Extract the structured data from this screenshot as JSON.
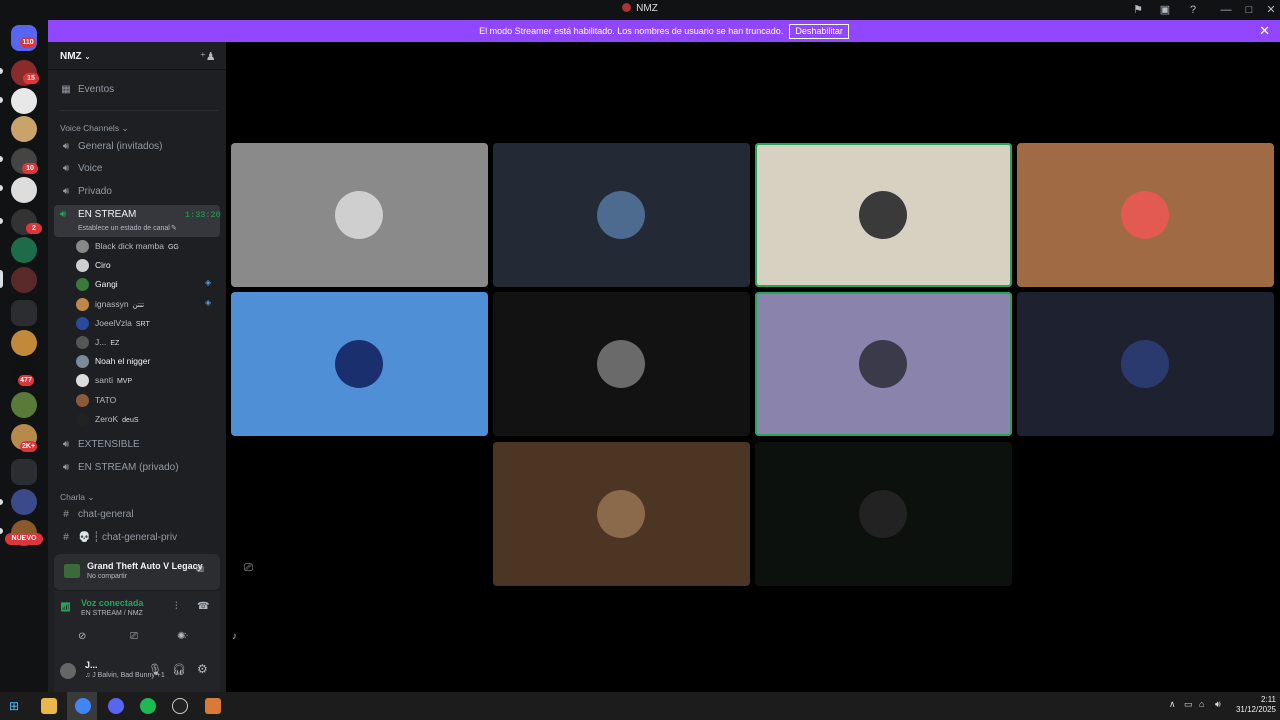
{
  "window": {
    "title": "NMZ"
  },
  "streamer_banner": {
    "message": "El modo Streamer está habilitado. Los nombres de usuario se han truncado.",
    "disable_label": "Deshabilitar"
  },
  "rail_badges": [
    "110",
    "15",
    "10",
    "2",
    "477",
    "2K+"
  ],
  "rail_new_label": "NUEVO",
  "server": {
    "name": "NMZ"
  },
  "events_label": "Eventos",
  "voice_category": "Voice Channels",
  "channels": [
    {
      "name": "General (invitados)"
    },
    {
      "name": "Voice"
    },
    {
      "name": "Privado"
    }
  ],
  "active_channel": {
    "name": "EN STREAM",
    "timer": "1:33:20",
    "status": "Establece un estado de canal"
  },
  "voice_users": [
    {
      "name": "Black dick mamba",
      "tag": "GG",
      "color": "#888888"
    },
    {
      "name": "Ciro",
      "tag": "",
      "color": "#cfcfcf"
    },
    {
      "name": "Gangi",
      "tag": "",
      "color": "#3a7a3a"
    },
    {
      "name": "ignassyn",
      "tag": "تتتن",
      "color": "#c0874a"
    },
    {
      "name": "JoeelVzla",
      "tag": "SRT",
      "color": "#2a4a9a"
    },
    {
      "name": "J...",
      "tag": "EZ",
      "color": "#555555"
    },
    {
      "name": "Noah el nigger",
      "tag": "",
      "color": "#7a8a9a"
    },
    {
      "name": "santi",
      "tag": "MVP",
      "color": "#dddddd"
    },
    {
      "name": "TATO",
      "tag": "",
      "color": "#8a5a3a"
    },
    {
      "name": "ZeroK",
      "tag": "deuS",
      "color": "#222222"
    }
  ],
  "more_channels": [
    {
      "name": "EXTENSIBLE"
    },
    {
      "name": "EN STREAM (privado)"
    }
  ],
  "text_category": "Charla",
  "text_channels": [
    {
      "name": "chat-general"
    },
    {
      "name": "💀 ┆ chat-general-priv"
    }
  ],
  "activity": {
    "game": "Grand Theft Auto V Legacy",
    "status": "No compartir"
  },
  "voice_connection": {
    "status": "Voz conectada",
    "location": "EN STREAM / NMZ"
  },
  "user": {
    "name": "J...",
    "status": "J Balvin, Bad Bunny +1"
  },
  "tiles": [
    {
      "bg": "#8a8a8a",
      "avatar": "#cfcfcf",
      "speaking": false
    },
    {
      "bg": "#232a35",
      "avatar": "#4d6a8f",
      "speaking": false
    },
    {
      "bg": "#d6d1c1",
      "avatar": "#3a3a3a",
      "speaking": true
    },
    {
      "bg": "#a06a45",
      "avatar": "#e25a52",
      "speaking": false
    },
    {
      "bg": "#4e8fd6",
      "avatar": "#1a2f6e",
      "speaking": false
    },
    {
      "bg": "#121212",
      "avatar": "#6a6a6a",
      "speaking": false
    },
    {
      "bg": "#8a84ad",
      "avatar": "#3a3a4a",
      "speaking": true
    },
    {
      "bg": "#1e2230",
      "avatar": "#2a3a6e",
      "speaking": false
    },
    {
      "bg": "#4d3524",
      "avatar": "#8a6a4a",
      "speaking": false
    },
    {
      "bg": "#0c110d",
      "avatar": "#222222",
      "speaking": false
    }
  ],
  "clock": {
    "time": "2:11",
    "date": "31/12/2025"
  }
}
